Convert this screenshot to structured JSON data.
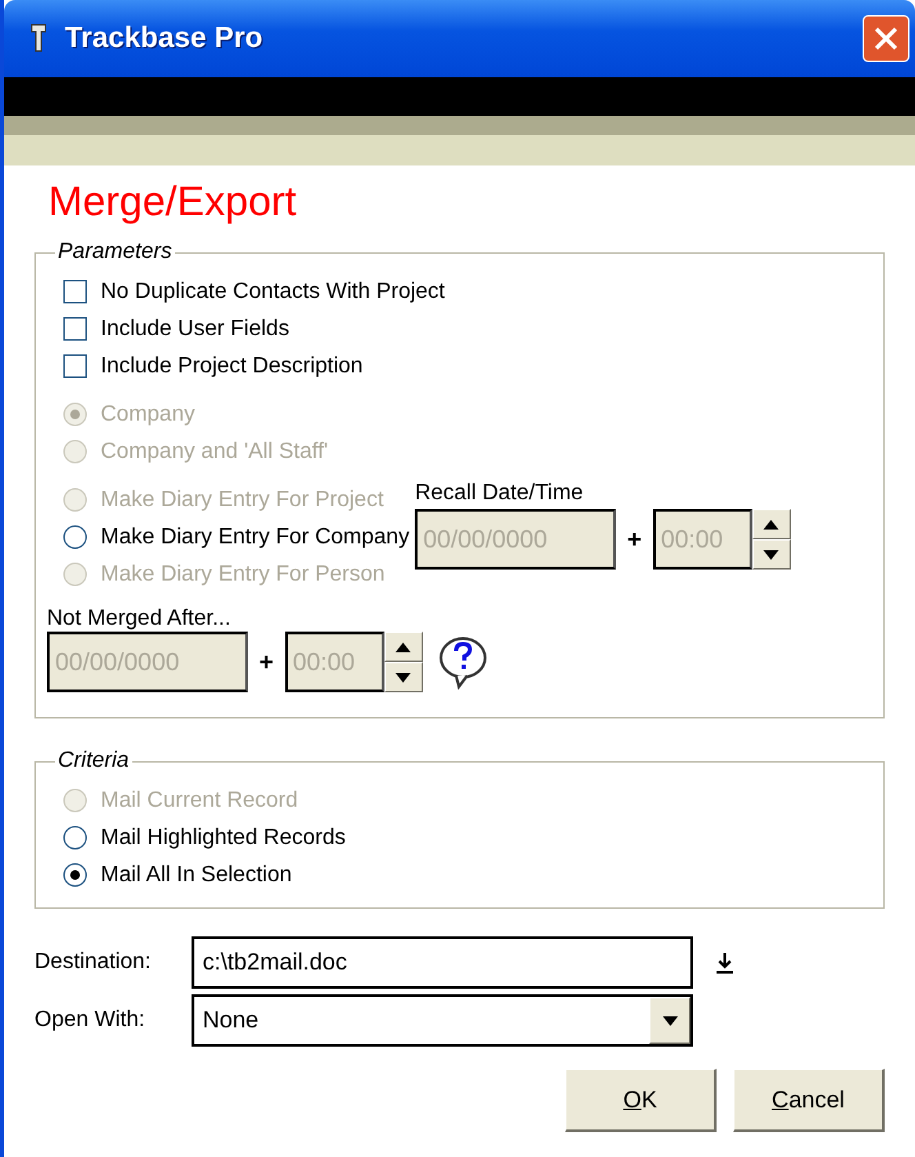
{
  "window": {
    "title": "Trackbase Pro"
  },
  "heading": "Merge/Export",
  "parameters": {
    "legend": "Parameters",
    "checkboxes": [
      {
        "label": "No Duplicate Contacts With Project",
        "checked": false
      },
      {
        "label": "Include User Fields",
        "checked": false
      },
      {
        "label": "Include Project Description",
        "checked": false
      }
    ],
    "scope_radios": [
      {
        "label": "Company",
        "selected": true,
        "disabled": true
      },
      {
        "label": "Company and 'All Staff'",
        "selected": false,
        "disabled": true
      }
    ],
    "diary_radios": [
      {
        "label": "Make Diary Entry For Project",
        "selected": false,
        "disabled": true
      },
      {
        "label": "Make Diary Entry For Company",
        "selected": false,
        "disabled": false
      },
      {
        "label": "Make Diary Entry For Person",
        "selected": false,
        "disabled": true
      }
    ],
    "recall": {
      "label": "Recall Date/Time",
      "date": "00/00/0000",
      "plus": "+",
      "time": "00:00"
    },
    "not_merged": {
      "label": "Not Merged After...",
      "date": "00/00/0000",
      "plus": "+",
      "time": "00:00"
    }
  },
  "criteria": {
    "legend": "Criteria",
    "radios": [
      {
        "label": "Mail Current Record",
        "selected": false,
        "disabled": true
      },
      {
        "label": "Mail Highlighted Records",
        "selected": false,
        "disabled": false
      },
      {
        "label": "Mail All In Selection",
        "selected": true,
        "disabled": false
      }
    ]
  },
  "destination": {
    "label": "Destination:",
    "value": "c:\\tb2mail.doc"
  },
  "open_with": {
    "label": "Open With:",
    "value": "None"
  },
  "buttons": [
    {
      "label": "OK",
      "underline_first": true
    },
    {
      "label": "Cancel",
      "underline_first": true
    }
  ]
}
